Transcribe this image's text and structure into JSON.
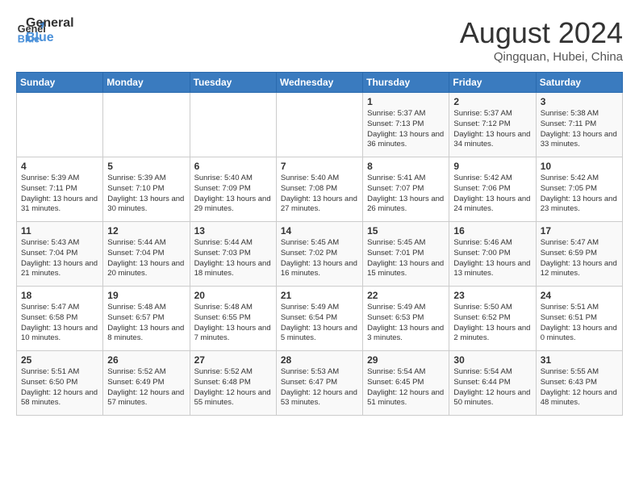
{
  "logo": {
    "line1": "General",
    "line2": "Blue"
  },
  "title": "August 2024",
  "subtitle": "Qingquan, Hubei, China",
  "days_of_week": [
    "Sunday",
    "Monday",
    "Tuesday",
    "Wednesday",
    "Thursday",
    "Friday",
    "Saturday"
  ],
  "weeks": [
    [
      {
        "day": "",
        "info": ""
      },
      {
        "day": "",
        "info": ""
      },
      {
        "day": "",
        "info": ""
      },
      {
        "day": "",
        "info": ""
      },
      {
        "day": "1",
        "info": "Sunrise: 5:37 AM\nSunset: 7:13 PM\nDaylight: 13 hours\nand 36 minutes."
      },
      {
        "day": "2",
        "info": "Sunrise: 5:37 AM\nSunset: 7:12 PM\nDaylight: 13 hours\nand 34 minutes."
      },
      {
        "day": "3",
        "info": "Sunrise: 5:38 AM\nSunset: 7:11 PM\nDaylight: 13 hours\nand 33 minutes."
      }
    ],
    [
      {
        "day": "4",
        "info": "Sunrise: 5:39 AM\nSunset: 7:11 PM\nDaylight: 13 hours\nand 31 minutes."
      },
      {
        "day": "5",
        "info": "Sunrise: 5:39 AM\nSunset: 7:10 PM\nDaylight: 13 hours\nand 30 minutes."
      },
      {
        "day": "6",
        "info": "Sunrise: 5:40 AM\nSunset: 7:09 PM\nDaylight: 13 hours\nand 29 minutes."
      },
      {
        "day": "7",
        "info": "Sunrise: 5:40 AM\nSunset: 7:08 PM\nDaylight: 13 hours\nand 27 minutes."
      },
      {
        "day": "8",
        "info": "Sunrise: 5:41 AM\nSunset: 7:07 PM\nDaylight: 13 hours\nand 26 minutes."
      },
      {
        "day": "9",
        "info": "Sunrise: 5:42 AM\nSunset: 7:06 PM\nDaylight: 13 hours\nand 24 minutes."
      },
      {
        "day": "10",
        "info": "Sunrise: 5:42 AM\nSunset: 7:05 PM\nDaylight: 13 hours\nand 23 minutes."
      }
    ],
    [
      {
        "day": "11",
        "info": "Sunrise: 5:43 AM\nSunset: 7:04 PM\nDaylight: 13 hours\nand 21 minutes."
      },
      {
        "day": "12",
        "info": "Sunrise: 5:44 AM\nSunset: 7:04 PM\nDaylight: 13 hours\nand 20 minutes."
      },
      {
        "day": "13",
        "info": "Sunrise: 5:44 AM\nSunset: 7:03 PM\nDaylight: 13 hours\nand 18 minutes."
      },
      {
        "day": "14",
        "info": "Sunrise: 5:45 AM\nSunset: 7:02 PM\nDaylight: 13 hours\nand 16 minutes."
      },
      {
        "day": "15",
        "info": "Sunrise: 5:45 AM\nSunset: 7:01 PM\nDaylight: 13 hours\nand 15 minutes."
      },
      {
        "day": "16",
        "info": "Sunrise: 5:46 AM\nSunset: 7:00 PM\nDaylight: 13 hours\nand 13 minutes."
      },
      {
        "day": "17",
        "info": "Sunrise: 5:47 AM\nSunset: 6:59 PM\nDaylight: 13 hours\nand 12 minutes."
      }
    ],
    [
      {
        "day": "18",
        "info": "Sunrise: 5:47 AM\nSunset: 6:58 PM\nDaylight: 13 hours\nand 10 minutes."
      },
      {
        "day": "19",
        "info": "Sunrise: 5:48 AM\nSunset: 6:57 PM\nDaylight: 13 hours\nand 8 minutes."
      },
      {
        "day": "20",
        "info": "Sunrise: 5:48 AM\nSunset: 6:55 PM\nDaylight: 13 hours\nand 7 minutes."
      },
      {
        "day": "21",
        "info": "Sunrise: 5:49 AM\nSunset: 6:54 PM\nDaylight: 13 hours\nand 5 minutes."
      },
      {
        "day": "22",
        "info": "Sunrise: 5:49 AM\nSunset: 6:53 PM\nDaylight: 13 hours\nand 3 minutes."
      },
      {
        "day": "23",
        "info": "Sunrise: 5:50 AM\nSunset: 6:52 PM\nDaylight: 13 hours\nand 2 minutes."
      },
      {
        "day": "24",
        "info": "Sunrise: 5:51 AM\nSunset: 6:51 PM\nDaylight: 13 hours\nand 0 minutes."
      }
    ],
    [
      {
        "day": "25",
        "info": "Sunrise: 5:51 AM\nSunset: 6:50 PM\nDaylight: 12 hours\nand 58 minutes."
      },
      {
        "day": "26",
        "info": "Sunrise: 5:52 AM\nSunset: 6:49 PM\nDaylight: 12 hours\nand 57 minutes."
      },
      {
        "day": "27",
        "info": "Sunrise: 5:52 AM\nSunset: 6:48 PM\nDaylight: 12 hours\nand 55 minutes."
      },
      {
        "day": "28",
        "info": "Sunrise: 5:53 AM\nSunset: 6:47 PM\nDaylight: 12 hours\nand 53 minutes."
      },
      {
        "day": "29",
        "info": "Sunrise: 5:54 AM\nSunset: 6:45 PM\nDaylight: 12 hours\nand 51 minutes."
      },
      {
        "day": "30",
        "info": "Sunrise: 5:54 AM\nSunset: 6:44 PM\nDaylight: 12 hours\nand 50 minutes."
      },
      {
        "day": "31",
        "info": "Sunrise: 5:55 AM\nSunset: 6:43 PM\nDaylight: 12 hours\nand 48 minutes."
      }
    ]
  ]
}
